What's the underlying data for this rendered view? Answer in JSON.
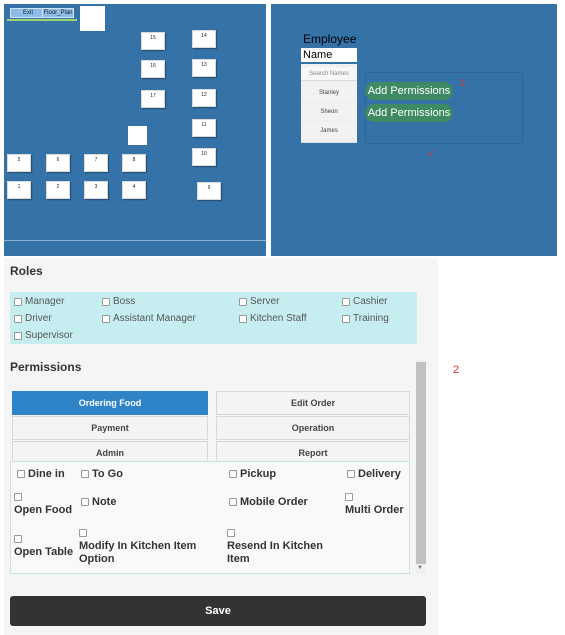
{
  "floor_plan": {
    "exit_label": "Exit",
    "floor_plan_label": "Floor_Plan",
    "tables": [
      "15",
      "14",
      "16",
      "13",
      "17",
      "12",
      "11",
      "10",
      "5",
      "6",
      "7",
      "8",
      "1",
      "2",
      "3",
      "4",
      "9"
    ]
  },
  "employee": {
    "title": "Employee",
    "name_header": "Name",
    "search_placeholder": "Search Names",
    "names": [
      "Stanley",
      "Sheon",
      "James"
    ],
    "add_permissions_label": "Add Permissions",
    "annotation_2": "2",
    "annotation_arrow": "↙"
  },
  "side_annotation": "2",
  "roles": {
    "heading": "Roles",
    "items": [
      "Manager",
      "Boss",
      "Server",
      "Cashier",
      "Driver",
      "Assistant Manager",
      "Kitchen Staff",
      "Training",
      "Supervisor"
    ]
  },
  "permissions": {
    "heading": "Permissions",
    "tabs": [
      "Ordering Food",
      "Edit Order",
      "Payment",
      "Operation",
      "Admin",
      "Report"
    ],
    "active_tab": "Ordering Food",
    "options": [
      "Dine in",
      "To Go",
      "Pickup",
      "Delivery",
      "Open Food",
      "Note",
      "Mobile Order",
      "Multi Order",
      "Open Table",
      "Modify In Kitchen Item Option",
      "Resend In Kitchen Item"
    ]
  },
  "save_label": "Save",
  "colors": {
    "panel_blue": "#3572a8",
    "active_tab": "#2f84c8",
    "roles_bg": "#c6eef0",
    "add_permissions": "#3e8a62",
    "save_button": "#333333",
    "annotation_red": "#dd3333"
  }
}
